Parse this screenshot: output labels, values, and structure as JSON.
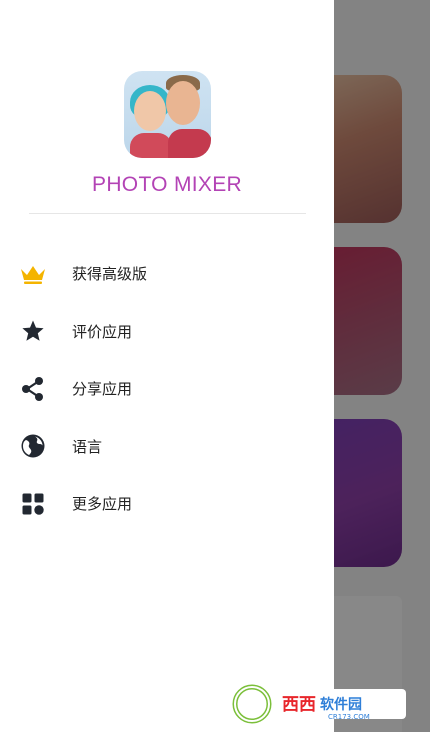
{
  "drawer": {
    "app_title": "PHOTO MIXER",
    "menu": [
      {
        "label": "获得高级版",
        "icon": "crown-icon",
        "color": "#f4b400"
      },
      {
        "label": "评价应用",
        "icon": "star-icon",
        "color": "#222831"
      },
      {
        "label": "分享应用",
        "icon": "share-icon",
        "color": "#222831"
      },
      {
        "label": "语言",
        "icon": "globe-icon",
        "color": "#222831"
      },
      {
        "label": "更多应用",
        "icon": "apps-grid-icon",
        "color": "#222831"
      }
    ]
  },
  "watermark": {
    "brand": "西西软件园",
    "url": "CR173.COM"
  },
  "colors": {
    "accent": "#b343b5",
    "scrim": "rgba(0,0,0,0.45)"
  }
}
